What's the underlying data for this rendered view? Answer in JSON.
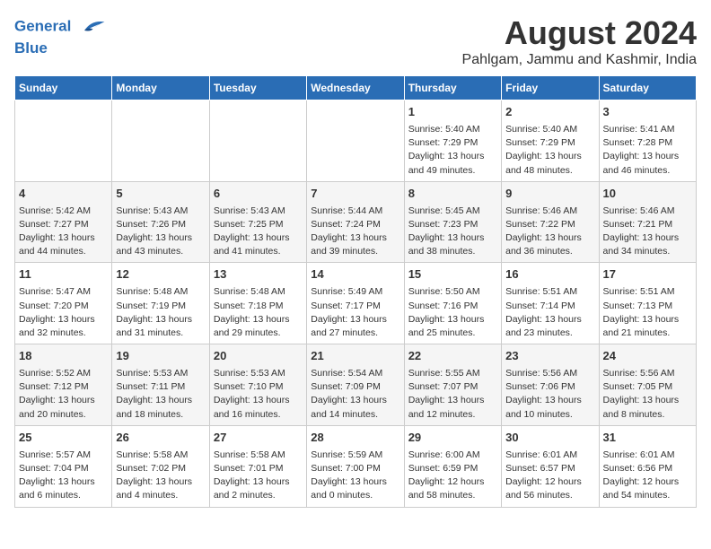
{
  "header": {
    "logo_line1": "General",
    "logo_line2": "Blue",
    "title": "August 2024",
    "subtitle": "Pahlgam, Jammu and Kashmir, India"
  },
  "days_of_week": [
    "Sunday",
    "Monday",
    "Tuesday",
    "Wednesday",
    "Thursday",
    "Friday",
    "Saturday"
  ],
  "weeks": [
    [
      {
        "day": "",
        "content": ""
      },
      {
        "day": "",
        "content": ""
      },
      {
        "day": "",
        "content": ""
      },
      {
        "day": "",
        "content": ""
      },
      {
        "day": "1",
        "content": "Sunrise: 5:40 AM\nSunset: 7:29 PM\nDaylight: 13 hours\nand 49 minutes."
      },
      {
        "day": "2",
        "content": "Sunrise: 5:40 AM\nSunset: 7:29 PM\nDaylight: 13 hours\nand 48 minutes."
      },
      {
        "day": "3",
        "content": "Sunrise: 5:41 AM\nSunset: 7:28 PM\nDaylight: 13 hours\nand 46 minutes."
      }
    ],
    [
      {
        "day": "4",
        "content": "Sunrise: 5:42 AM\nSunset: 7:27 PM\nDaylight: 13 hours\nand 44 minutes."
      },
      {
        "day": "5",
        "content": "Sunrise: 5:43 AM\nSunset: 7:26 PM\nDaylight: 13 hours\nand 43 minutes."
      },
      {
        "day": "6",
        "content": "Sunrise: 5:43 AM\nSunset: 7:25 PM\nDaylight: 13 hours\nand 41 minutes."
      },
      {
        "day": "7",
        "content": "Sunrise: 5:44 AM\nSunset: 7:24 PM\nDaylight: 13 hours\nand 39 minutes."
      },
      {
        "day": "8",
        "content": "Sunrise: 5:45 AM\nSunset: 7:23 PM\nDaylight: 13 hours\nand 38 minutes."
      },
      {
        "day": "9",
        "content": "Sunrise: 5:46 AM\nSunset: 7:22 PM\nDaylight: 13 hours\nand 36 minutes."
      },
      {
        "day": "10",
        "content": "Sunrise: 5:46 AM\nSunset: 7:21 PM\nDaylight: 13 hours\nand 34 minutes."
      }
    ],
    [
      {
        "day": "11",
        "content": "Sunrise: 5:47 AM\nSunset: 7:20 PM\nDaylight: 13 hours\nand 32 minutes."
      },
      {
        "day": "12",
        "content": "Sunrise: 5:48 AM\nSunset: 7:19 PM\nDaylight: 13 hours\nand 31 minutes."
      },
      {
        "day": "13",
        "content": "Sunrise: 5:48 AM\nSunset: 7:18 PM\nDaylight: 13 hours\nand 29 minutes."
      },
      {
        "day": "14",
        "content": "Sunrise: 5:49 AM\nSunset: 7:17 PM\nDaylight: 13 hours\nand 27 minutes."
      },
      {
        "day": "15",
        "content": "Sunrise: 5:50 AM\nSunset: 7:16 PM\nDaylight: 13 hours\nand 25 minutes."
      },
      {
        "day": "16",
        "content": "Sunrise: 5:51 AM\nSunset: 7:14 PM\nDaylight: 13 hours\nand 23 minutes."
      },
      {
        "day": "17",
        "content": "Sunrise: 5:51 AM\nSunset: 7:13 PM\nDaylight: 13 hours\nand 21 minutes."
      }
    ],
    [
      {
        "day": "18",
        "content": "Sunrise: 5:52 AM\nSunset: 7:12 PM\nDaylight: 13 hours\nand 20 minutes."
      },
      {
        "day": "19",
        "content": "Sunrise: 5:53 AM\nSunset: 7:11 PM\nDaylight: 13 hours\nand 18 minutes."
      },
      {
        "day": "20",
        "content": "Sunrise: 5:53 AM\nSunset: 7:10 PM\nDaylight: 13 hours\nand 16 minutes."
      },
      {
        "day": "21",
        "content": "Sunrise: 5:54 AM\nSunset: 7:09 PM\nDaylight: 13 hours\nand 14 minutes."
      },
      {
        "day": "22",
        "content": "Sunrise: 5:55 AM\nSunset: 7:07 PM\nDaylight: 13 hours\nand 12 minutes."
      },
      {
        "day": "23",
        "content": "Sunrise: 5:56 AM\nSunset: 7:06 PM\nDaylight: 13 hours\nand 10 minutes."
      },
      {
        "day": "24",
        "content": "Sunrise: 5:56 AM\nSunset: 7:05 PM\nDaylight: 13 hours\nand 8 minutes."
      }
    ],
    [
      {
        "day": "25",
        "content": "Sunrise: 5:57 AM\nSunset: 7:04 PM\nDaylight: 13 hours\nand 6 minutes."
      },
      {
        "day": "26",
        "content": "Sunrise: 5:58 AM\nSunset: 7:02 PM\nDaylight: 13 hours\nand 4 minutes."
      },
      {
        "day": "27",
        "content": "Sunrise: 5:58 AM\nSunset: 7:01 PM\nDaylight: 13 hours\nand 2 minutes."
      },
      {
        "day": "28",
        "content": "Sunrise: 5:59 AM\nSunset: 7:00 PM\nDaylight: 13 hours\nand 0 minutes."
      },
      {
        "day": "29",
        "content": "Sunrise: 6:00 AM\nSunset: 6:59 PM\nDaylight: 12 hours\nand 58 minutes."
      },
      {
        "day": "30",
        "content": "Sunrise: 6:01 AM\nSunset: 6:57 PM\nDaylight: 12 hours\nand 56 minutes."
      },
      {
        "day": "31",
        "content": "Sunrise: 6:01 AM\nSunset: 6:56 PM\nDaylight: 12 hours\nand 54 minutes."
      }
    ]
  ]
}
